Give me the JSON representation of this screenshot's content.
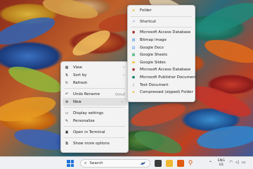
{
  "main_menu": {
    "items": [
      {
        "label": "View",
        "icon": "view-grid-icon",
        "submenu": true
      },
      {
        "label": "Sort by",
        "icon": "sort-icon",
        "submenu": true
      },
      {
        "label": "Refresh",
        "icon": "refresh-icon"
      },
      {
        "label": "Undo Rename",
        "icon": "undo-icon",
        "shortcut": "Ctrl+Z"
      },
      {
        "label": "New",
        "icon": "new-plus-icon",
        "submenu": true,
        "highlighted": true
      },
      {
        "label": "Display settings",
        "icon": "display-icon"
      },
      {
        "label": "Personalize",
        "icon": "personalize-brush-icon"
      },
      {
        "label": "Open in Terminal",
        "icon": "terminal-icon"
      },
      {
        "label": "Show more options",
        "icon": "more-options-icon"
      }
    ]
  },
  "new_submenu": {
    "items": [
      {
        "label": "Folder",
        "icon": "folder-icon",
        "color": "#e8b838"
      },
      {
        "label": "Shortcut",
        "icon": "shortcut-icon",
        "color": "#3a7bd5"
      },
      {
        "label": "Microsoft Access Database",
        "icon": "access-db-icon",
        "color": "#a4373a"
      },
      {
        "label": "Bitmap image",
        "icon": "bitmap-icon",
        "color": "#2a8ad8"
      },
      {
        "label": "Google Docs",
        "icon": "google-docs-icon",
        "color": "#4285f4"
      },
      {
        "label": "Google Sheets",
        "icon": "google-sheets-icon",
        "color": "#0f9d58"
      },
      {
        "label": "Google Slides",
        "icon": "google-slides-icon",
        "color": "#f4b400"
      },
      {
        "label": "Microsoft Access Database",
        "icon": "access-db-icon",
        "color": "#a4373a"
      },
      {
        "label": "Microsoft Publisher Document",
        "icon": "publisher-icon",
        "color": "#077568"
      },
      {
        "label": "Text Document",
        "icon": "text-document-icon",
        "color": "#888888"
      },
      {
        "label": "Compressed (zipped) Folder",
        "icon": "zip-folder-icon",
        "color": "#e8b838"
      }
    ]
  },
  "taskbar": {
    "search_label": "Search",
    "lang_top": "ENG",
    "lang_bottom": "ES"
  }
}
